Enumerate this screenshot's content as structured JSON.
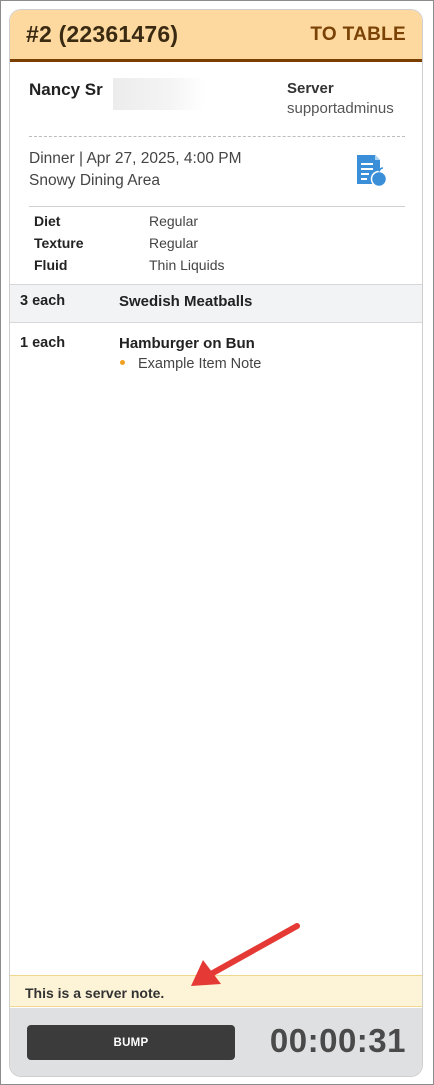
{
  "ticket": {
    "order_number": "#2 (22361476)",
    "order_type": "TO TABLE",
    "header_color": "#fdd9a0",
    "accent_color": "#7a3f00"
  },
  "patient": {
    "name": "Nancy Sr",
    "server_label": "Server",
    "server_value": "supportadminus"
  },
  "meal": {
    "line1": "Dinner | Apr 27, 2025, 4:00 PM",
    "line2": "Snowy Dining Area",
    "icon": "meal-menu-icon"
  },
  "diet": [
    {
      "key": "Diet",
      "value": "Regular"
    },
    {
      "key": "Texture",
      "value": "Regular"
    },
    {
      "key": "Fluid",
      "value": "Thin Liquids"
    }
  ],
  "items": [
    {
      "qty": "3 each",
      "name": "Swedish Meatballs",
      "note": ""
    },
    {
      "qty": "1 each",
      "name": "Hamburger on Bun",
      "note": "Example Item Note"
    }
  ],
  "server_note": "This is a server note.",
  "footer": {
    "bump_label": "BUMP",
    "timer": "00:00:31"
  }
}
